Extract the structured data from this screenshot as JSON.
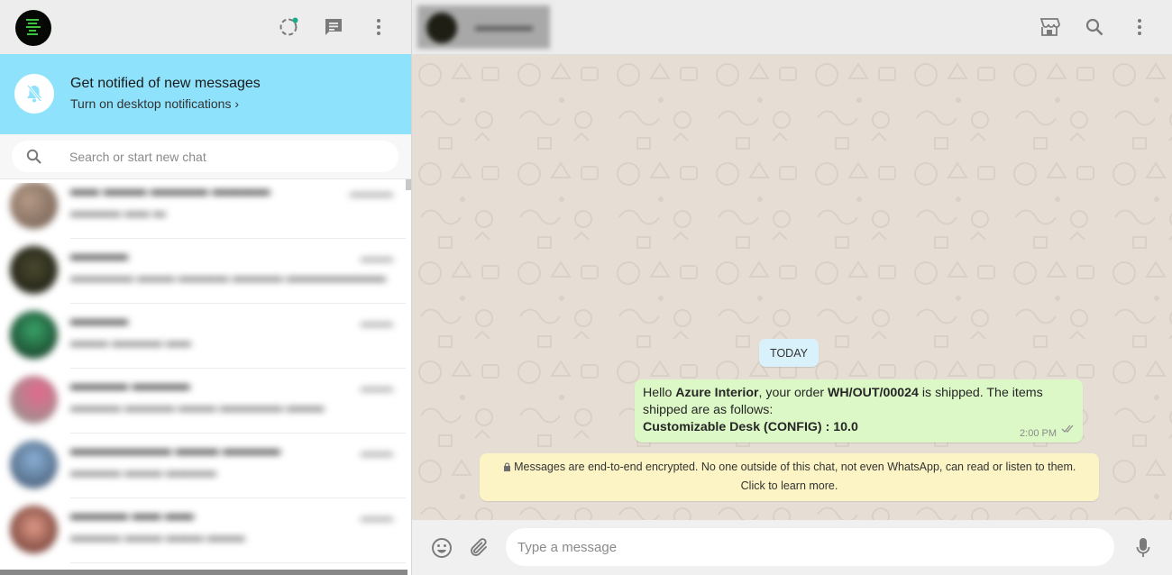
{
  "sidebar": {
    "header": {
      "icons": [
        "status-icon",
        "new-chat-icon",
        "menu-icon"
      ],
      "status_dot_color": "#1aab8a"
    },
    "notification": {
      "title": "Get notified of new messages",
      "action": "Turn on desktop notifications ›",
      "color": "#8ee2fb"
    },
    "search": {
      "placeholder": "Search or start new chat"
    }
  },
  "conversation": {
    "date_divider": "TODAY",
    "message": {
      "greeting": "Hello ",
      "customer": "Azure Interior",
      "mid1": ", your order ",
      "order": "WH/OUT/00024",
      "mid2": " is shipped. The items shipped are as follows:",
      "item_line": "Customizable Desk (CONFIG) : 10.0",
      "time": "2:00 PM"
    },
    "encryption_notice": {
      "line1": "Messages are end-to-end encrypted. No one outside of this chat, not even WhatsApp, can read or listen to them.",
      "line2": "Click to learn more."
    }
  },
  "composer": {
    "placeholder": "Type a message"
  },
  "colors": {
    "outgoing_bubble": "#dcf8c6",
    "wallpaper": "#e6ded5",
    "date_chip": "#d9f1fb",
    "encryption_chip": "#fcf4c4"
  }
}
